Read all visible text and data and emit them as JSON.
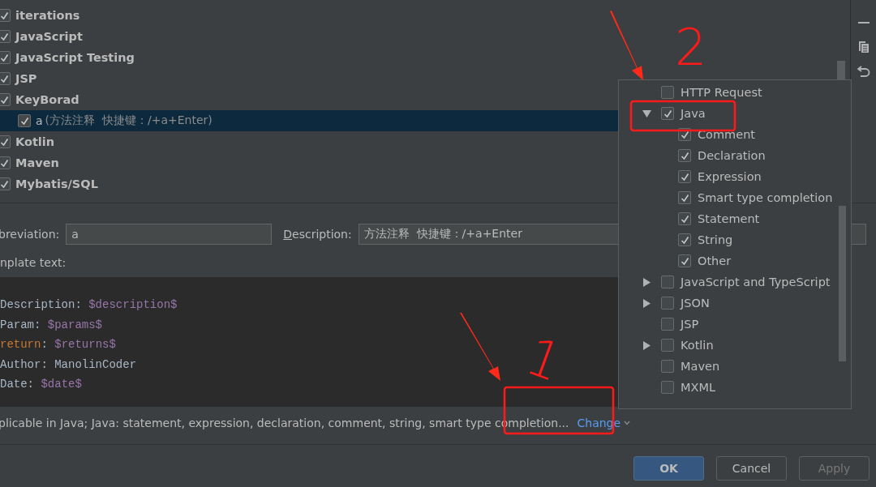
{
  "template_groups": [
    {
      "name": "iterations",
      "checked": true,
      "selected": false
    },
    {
      "name": "JavaScript",
      "checked": true,
      "selected": false
    },
    {
      "name": "JavaScript Testing",
      "checked": true,
      "selected": false
    },
    {
      "name": "JSP",
      "checked": true,
      "selected": false
    },
    {
      "name": "KeyBorad",
      "checked": true,
      "selected": false,
      "children": [
        {
          "name": "a",
          "description": "(方法注释  快捷键：/+a+Enter)",
          "checked": true,
          "selected": true
        }
      ]
    },
    {
      "name": "Kotlin",
      "checked": true,
      "selected": false
    },
    {
      "name": "Maven",
      "checked": true,
      "selected": false
    },
    {
      "name": "Mybatis/SQL",
      "checked": true,
      "selected": false
    }
  ],
  "abbreviation": {
    "label": "breviation:",
    "value": "a"
  },
  "description": {
    "label": "Description:",
    "value": "方法注释  快捷键：/+a+Enter"
  },
  "template_text": {
    "label": "nplate text:",
    "lines": [
      [
        {
          "kind": "plain",
          "text": "Description: "
        },
        {
          "kind": "variable",
          "text": "$description$"
        }
      ],
      [
        {
          "kind": "plain",
          "text": "Param: "
        },
        {
          "kind": "variable",
          "text": "$params$"
        }
      ],
      [
        {
          "kind": "keyword",
          "text": "return"
        },
        {
          "kind": "plain",
          "text": ": "
        },
        {
          "kind": "variable",
          "text": "$returns$"
        }
      ],
      [
        {
          "kind": "plain",
          "text": "Author: ManolinCoder"
        }
      ],
      [
        {
          "kind": "plain",
          "text": "Date: "
        },
        {
          "kind": "variable",
          "text": "$date$"
        }
      ]
    ]
  },
  "applicable": {
    "text": "plicable in Java; Java: statement, expression, declaration, comment, string, smart type completion...",
    "link": "Change"
  },
  "buttons": [
    {
      "label": "OK",
      "kind": "default",
      "disabled": false
    },
    {
      "label": "Cancel",
      "kind": "normal",
      "disabled": false
    },
    {
      "label": "Apply",
      "kind": "normal",
      "disabled": true
    }
  ],
  "context_popup": {
    "items": [
      {
        "kind": "leaf",
        "name": "HTTP Request",
        "checked": false
      },
      {
        "kind": "group",
        "name": "Java",
        "checked": true,
        "expanded": true,
        "children": [
          {
            "name": "Comment",
            "checked": true
          },
          {
            "name": "Declaration",
            "checked": true
          },
          {
            "name": "Expression",
            "checked": true
          },
          {
            "name": "Smart type completion",
            "checked": true
          },
          {
            "name": "Statement",
            "checked": true
          },
          {
            "name": "String",
            "checked": true
          },
          {
            "name": "Other",
            "checked": true
          }
        ]
      },
      {
        "kind": "group",
        "name": "JavaScript and TypeScript",
        "checked": false,
        "expanded": false
      },
      {
        "kind": "group",
        "name": "JSON",
        "checked": false,
        "expanded": false
      },
      {
        "kind": "leaf",
        "name": "JSP",
        "checked": false
      },
      {
        "kind": "group",
        "name": "Kotlin",
        "checked": false,
        "expanded": false
      },
      {
        "kind": "leaf",
        "name": "Maven",
        "checked": false
      },
      {
        "kind": "leaf",
        "name": "MXML",
        "checked": false
      }
    ]
  },
  "annotations": [
    {
      "kind": "arrow"
    },
    {
      "kind": "number",
      "text": "2"
    },
    {
      "kind": "frame"
    },
    {
      "kind": "arrow"
    },
    {
      "kind": "number",
      "text": "1"
    },
    {
      "kind": "frame"
    }
  ]
}
